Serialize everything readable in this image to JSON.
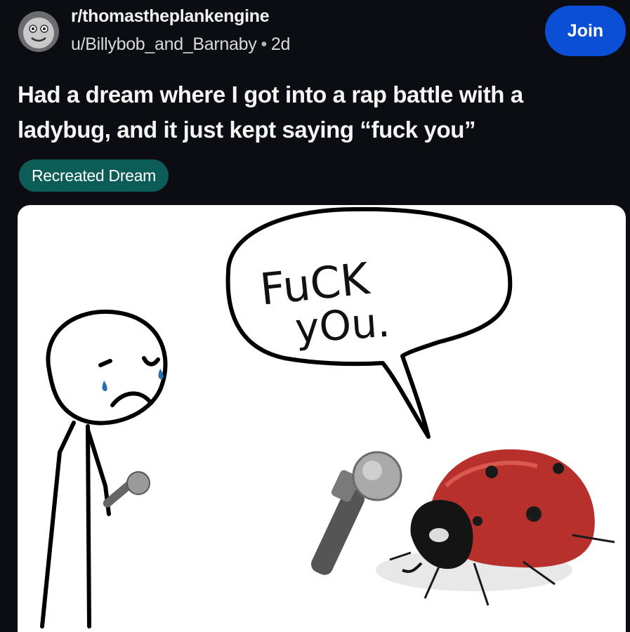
{
  "post": {
    "subreddit": "r/thomastheplankengine",
    "author": "u/Billybob_and_Barnaby",
    "separator": "•",
    "age": "2d",
    "join_label": "Join",
    "title": "Had a dream where I got into a rap battle with a ladybug, and it just kept saying “fuck you”",
    "flair": "Recreated Dream"
  },
  "meme": {
    "speech_line1": "FuCK",
    "speech_line2": "yOu."
  },
  "colors": {
    "background": "#0b0d12",
    "join_button": "#0a4fd6",
    "flair": "#0c5d58",
    "ladybug_shell": "#b8302c"
  },
  "icons": {
    "avatar": "thomas-engine-face-icon",
    "microphone": "microphone-icon"
  }
}
